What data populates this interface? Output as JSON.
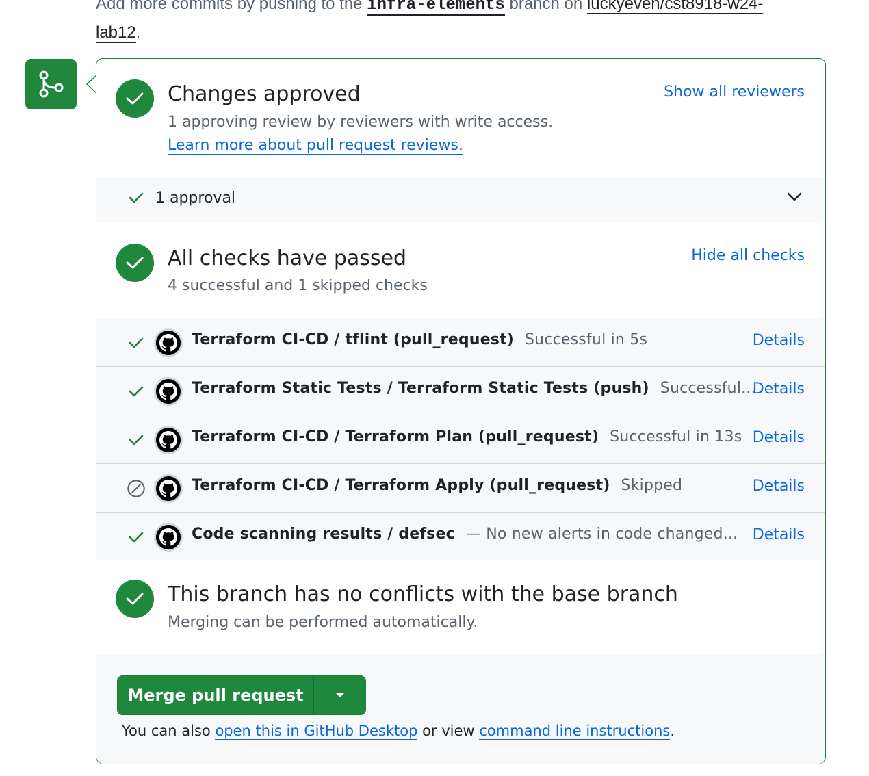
{
  "intro": {
    "prefix": "Add more commits by pushing to the ",
    "branch": "infra-elements",
    "middle": " branch on ",
    "repo": "luckyeven/cst8918-w24-",
    "repo_cont": "lab12",
    "suffix": "."
  },
  "approved": {
    "title": "Changes approved",
    "subtitle": "1 approving review by reviewers with write access.",
    "learn_link": "Learn more about pull request reviews.",
    "show_reviewers": "Show all reviewers",
    "approval_count": "1 approval"
  },
  "checks": {
    "title": "All checks have passed",
    "subtitle": "4 successful and 1 skipped checks",
    "hide_link": "Hide all checks",
    "items": [
      {
        "name": "Terraform CI-CD / tflint (pull_request)",
        "desc": "Successful in 5s",
        "state": "success",
        "details": "Details"
      },
      {
        "name": "Terraform Static Tests / Terraform Static Tests (push)",
        "desc": "Successful...",
        "state": "success",
        "details": "Details"
      },
      {
        "name": "Terraform CI-CD / Terraform Plan (pull_request)",
        "desc": "Successful in 13s",
        "state": "success",
        "details": "Details"
      },
      {
        "name": "Terraform CI-CD / Terraform Apply (pull_request)",
        "desc": "Skipped",
        "state": "skipped",
        "details": "Details"
      },
      {
        "name": "Code scanning results / defsec",
        "desc": "— No new alerts in code changed...",
        "state": "success",
        "details": "Details"
      }
    ]
  },
  "conflicts": {
    "title": "This branch has no conflicts with the base branch",
    "subtitle": "Merging can be performed automatically."
  },
  "merge": {
    "button_label": "Merge pull request",
    "note_prefix": "You can also ",
    "desktop_link": "open this in GitHub Desktop",
    "note_middle": " or view ",
    "cli_link": "command line instructions",
    "note_suffix": "."
  },
  "colors": {
    "success": "#1f883d",
    "link": "#0969da",
    "muted": "#59636e",
    "border": "#d1d9e0"
  }
}
